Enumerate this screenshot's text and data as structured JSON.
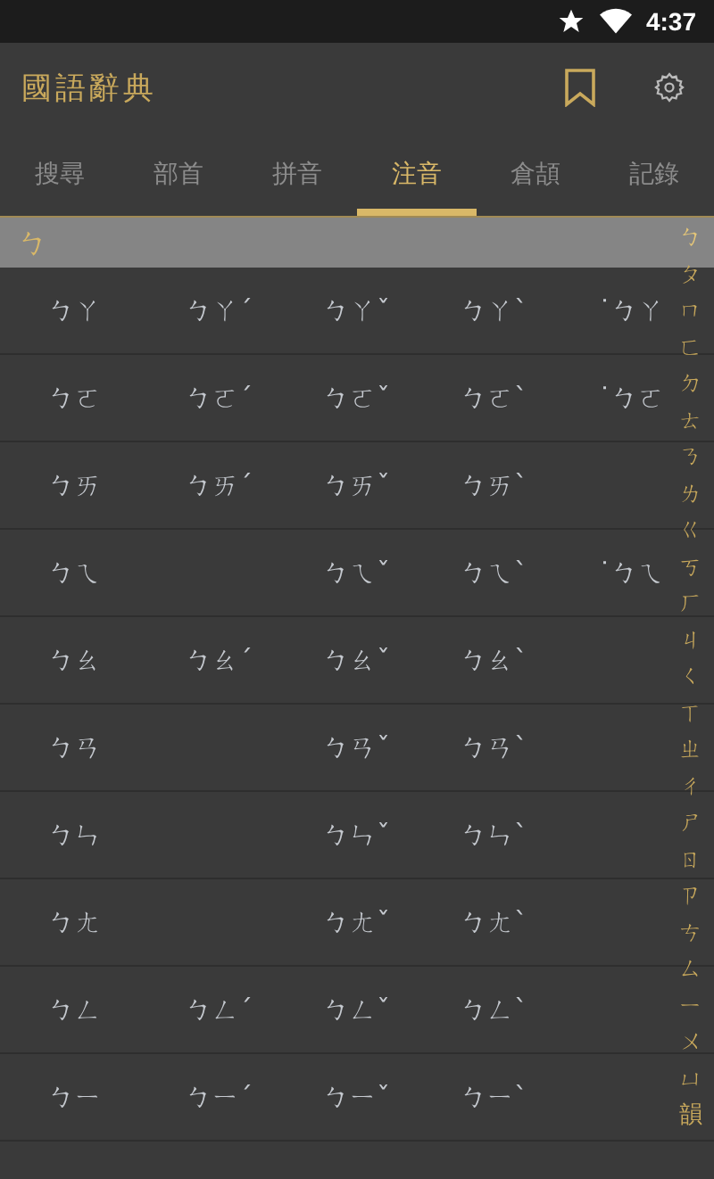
{
  "status_bar": {
    "time": "4:37"
  },
  "app_bar": {
    "title": "國語辭典"
  },
  "tabs": [
    {
      "label": "搜尋",
      "selected": false
    },
    {
      "label": "部首",
      "selected": false
    },
    {
      "label": "拼音",
      "selected": false
    },
    {
      "label": "注音",
      "selected": true
    },
    {
      "label": "倉頡",
      "selected": false
    },
    {
      "label": "記錄",
      "selected": false
    }
  ],
  "section_header": "ㄅ",
  "rows": [
    {
      "tone1": "ㄅㄚ",
      "tone2": "ㄅㄚˊ",
      "tone3": "ㄅㄚˇ",
      "tone4": "ㄅㄚˋ",
      "neutral": "˙ㄅㄚ"
    },
    {
      "tone1": "ㄅㄛ",
      "tone2": "ㄅㄛˊ",
      "tone3": "ㄅㄛˇ",
      "tone4": "ㄅㄛˋ",
      "neutral": "˙ㄅㄛ"
    },
    {
      "tone1": "ㄅㄞ",
      "tone2": "ㄅㄞˊ",
      "tone3": "ㄅㄞˇ",
      "tone4": "ㄅㄞˋ"
    },
    {
      "tone1": "ㄅㄟ",
      "tone3": "ㄅㄟˇ",
      "tone4": "ㄅㄟˋ",
      "neutral": "˙ㄅㄟ"
    },
    {
      "tone1": "ㄅㄠ",
      "tone2": "ㄅㄠˊ",
      "tone3": "ㄅㄠˇ",
      "tone4": "ㄅㄠˋ"
    },
    {
      "tone1": "ㄅㄢ",
      "tone3": "ㄅㄢˇ",
      "tone4": "ㄅㄢˋ"
    },
    {
      "tone1": "ㄅㄣ",
      "tone3": "ㄅㄣˇ",
      "tone4": "ㄅㄣˋ"
    },
    {
      "tone1": "ㄅㄤ",
      "tone3": "ㄅㄤˇ",
      "tone4": "ㄅㄤˋ"
    },
    {
      "tone1": "ㄅㄥ",
      "tone2": "ㄅㄥˊ",
      "tone3": "ㄅㄥˇ",
      "tone4": "ㄅㄥˋ"
    },
    {
      "tone1": "ㄅㄧ",
      "tone2": "ㄅㄧˊ",
      "tone3": "ㄅㄧˇ",
      "tone4": "ㄅㄧˋ"
    }
  ],
  "index": [
    {
      "label": "ㄅ",
      "selected": true
    },
    {
      "label": "ㄆ",
      "selected": false
    },
    {
      "label": "ㄇ",
      "selected": false
    },
    {
      "label": "ㄈ",
      "selected": false
    },
    {
      "label": "ㄉ",
      "selected": false
    },
    {
      "label": "ㄊ",
      "selected": false
    },
    {
      "label": "ㄋ",
      "selected": false
    },
    {
      "label": "ㄌ",
      "selected": false
    },
    {
      "label": "ㄍ",
      "selected": false
    },
    {
      "label": "ㄎ",
      "selected": false
    },
    {
      "label": "ㄏ",
      "selected": false
    },
    {
      "label": "ㄐ",
      "selected": false
    },
    {
      "label": "ㄑ",
      "selected": false
    },
    {
      "label": "ㄒ",
      "selected": false
    },
    {
      "label": "ㄓ",
      "selected": false
    },
    {
      "label": "ㄔ",
      "selected": false
    },
    {
      "label": "ㄕ",
      "selected": false
    },
    {
      "label": "ㄖ",
      "selected": false
    },
    {
      "label": "ㄗ",
      "selected": false
    },
    {
      "label": "ㄘ",
      "selected": false
    },
    {
      "label": "ㄙ",
      "selected": false
    },
    {
      "label": "ㄧ",
      "selected": false
    },
    {
      "label": "ㄨ",
      "selected": false
    },
    {
      "label": "ㄩ",
      "selected": false
    },
    {
      "label": "韻",
      "selected": false
    }
  ]
}
